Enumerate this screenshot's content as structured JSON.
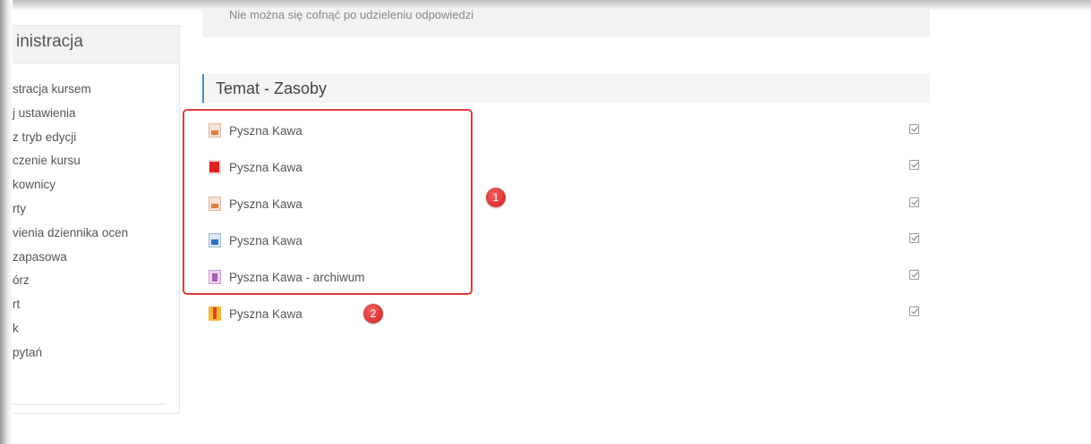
{
  "top_box": {
    "text": "Nie można się cofnąć po udzieleniu odpowiedzi"
  },
  "sidebar": {
    "title": "inistracja",
    "items": [
      "stracja kursem",
      "j ustawienia",
      "z tryb edycji",
      "czenie kursu",
      "kownicy",
      "rty",
      "vienia dziennika ocen",
      "zapasowa",
      "órz",
      "rt",
      "k",
      "pytań"
    ]
  },
  "section": {
    "title": "Temat - Zasoby"
  },
  "resources": [
    {
      "label": "Pyszna Kawa",
      "icon": "image-file-icon"
    },
    {
      "label": "Pyszna Kawa",
      "icon": "pdf-file-icon"
    },
    {
      "label": "Pyszna Kawa",
      "icon": "image-file-icon"
    },
    {
      "label": "Pyszna Kawa",
      "icon": "document-file-icon"
    },
    {
      "label": "Pyszna Kawa - archiwum",
      "icon": "archive-file-icon"
    },
    {
      "label": "Pyszna Kawa",
      "icon": "folder-icon"
    }
  ],
  "annotations": {
    "callout_1": "1",
    "callout_2": "2"
  },
  "colors": {
    "accent": "#3f8fd2",
    "highlight": "#e23a3a"
  }
}
